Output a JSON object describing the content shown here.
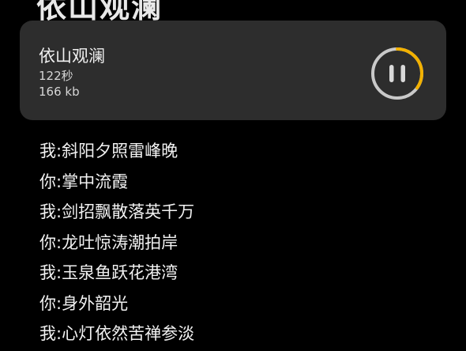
{
  "header": {
    "title": "依山观澜"
  },
  "audio_card": {
    "title": "依山观澜",
    "duration": "122秒",
    "size": "166 kb",
    "progress": 0.35,
    "colors": {
      "card_bg": "#2d2d2d",
      "progress_accent": "#f2b100",
      "ring_track": "#c9c9c9"
    },
    "control_icon": "pause-icon"
  },
  "dialogue": [
    {
      "speaker": "我",
      "sep": ":",
      "text": "斜阳夕照雷峰晚"
    },
    {
      "speaker": "你",
      "sep": ":",
      "text": "掌中流霞"
    },
    {
      "speaker": "我",
      "sep": ":",
      "text": "剑招飘散落英千万"
    },
    {
      "speaker": "你",
      "sep": ":",
      "text": "龙吐惊涛潮拍岸"
    },
    {
      "speaker": "我",
      "sep": ":",
      "text": "玉泉鱼跃花港湾"
    },
    {
      "speaker": "你",
      "sep": ":",
      "text": "身外韶光"
    },
    {
      "speaker": "我",
      "sep": ":",
      "text": "心灯依然苦禅参淡"
    }
  ]
}
